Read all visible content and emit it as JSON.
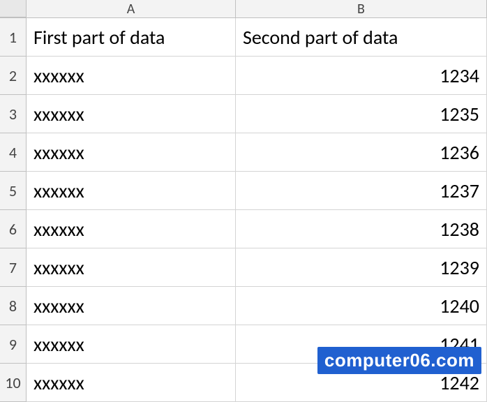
{
  "columns": {
    "a": "A",
    "b": "B"
  },
  "rows": [
    {
      "num": "1",
      "a": "First part of data",
      "b": "Second part of data"
    },
    {
      "num": "2",
      "a": "xxxxxx",
      "b": "1234"
    },
    {
      "num": "3",
      "a": "xxxxxx",
      "b": "1235"
    },
    {
      "num": "4",
      "a": "xxxxxx",
      "b": "1236"
    },
    {
      "num": "5",
      "a": "xxxxxx",
      "b": "1237"
    },
    {
      "num": "6",
      "a": "xxxxxx",
      "b": "1238"
    },
    {
      "num": "7",
      "a": "xxxxxx",
      "b": "1239"
    },
    {
      "num": "8",
      "a": "xxxxxx",
      "b": "1240"
    },
    {
      "num": "9",
      "a": "xxxxxx",
      "b": "1241"
    },
    {
      "num": "10",
      "a": "xxxxxx",
      "b": "1242"
    }
  ],
  "watermark": "computer06.com"
}
